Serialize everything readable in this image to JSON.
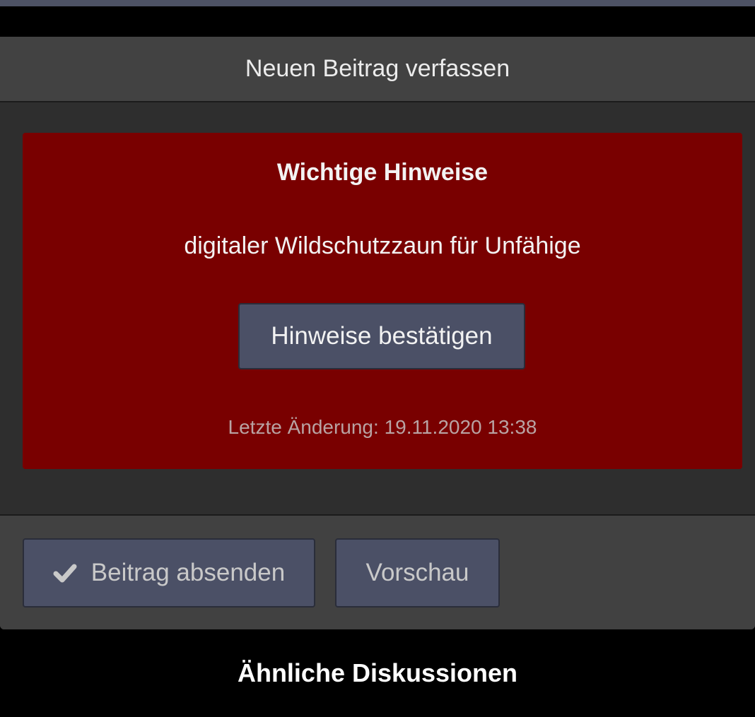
{
  "panel": {
    "header_title": "Neuen Beitrag verfassen"
  },
  "notice": {
    "title": "Wichtige Hinweise",
    "text": "digitaler Wildschutzzaun für Unfähige",
    "confirm_label": "Hinweise bestätigen",
    "last_change": "Letzte Änderung: 19.11.2020 13:38"
  },
  "actions": {
    "submit_label": "Beitrag absenden",
    "submit_icon": "check-icon",
    "preview_label": "Vorschau"
  },
  "similar": {
    "title": "Ähnliche Diskussionen"
  },
  "colors": {
    "notice_bg": "#790000",
    "button_bg": "#4b5066",
    "panel_bg": "#414141",
    "body_bg": "#2e2e2e"
  }
}
